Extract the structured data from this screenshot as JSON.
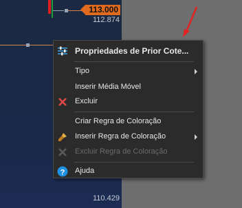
{
  "chart": {
    "price_tag": "113.000",
    "price_label_top": "112.874",
    "price_label_bottom": "110.429",
    "colors": {
      "price_tag": "#e06b1f",
      "line": "#d9834c",
      "candle_up": "#22a244",
      "candle_down": "#d22"
    }
  },
  "context_menu": {
    "header": "Propriedades de Prior Cote...",
    "items": [
      {
        "label": "Tipo",
        "submenu": true,
        "enabled": true,
        "icon": ""
      },
      {
        "label": "Inserir Média Móvel",
        "submenu": false,
        "enabled": true,
        "icon": ""
      },
      {
        "label": "Excluir",
        "submenu": false,
        "enabled": true,
        "icon": "delete-x-icon"
      },
      {
        "label": "Criar Regra de Coloração",
        "submenu": false,
        "enabled": true,
        "icon": ""
      },
      {
        "label": "Inserir Regra de Coloração",
        "submenu": true,
        "enabled": true,
        "icon": "paint-brush-icon"
      },
      {
        "label": "Excluir Regra de Coloração",
        "submenu": false,
        "enabled": false,
        "icon": "delete-x-icon"
      },
      {
        "label": "Ajuda",
        "submenu": false,
        "enabled": true,
        "icon": "help-icon"
      }
    ]
  }
}
